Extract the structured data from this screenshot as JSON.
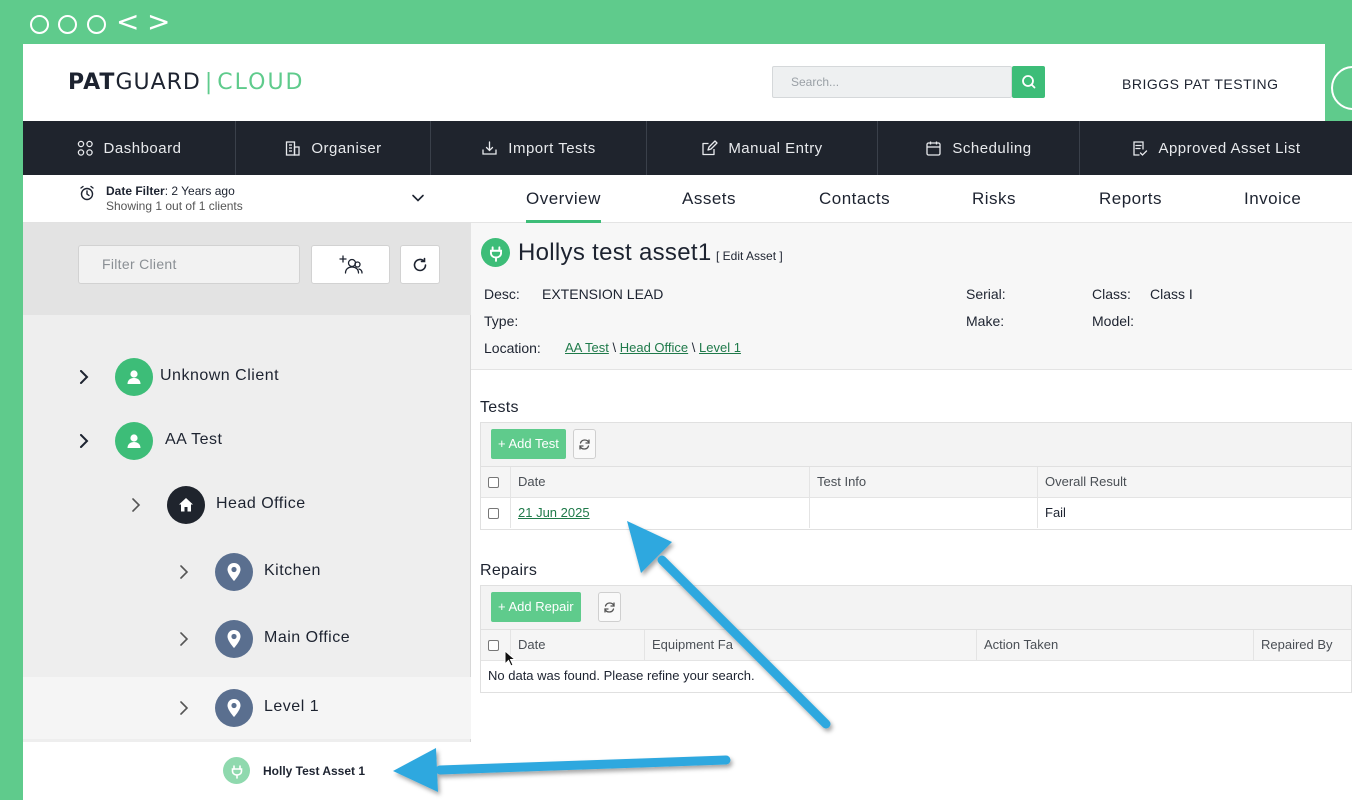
{
  "header": {
    "logo_bold": "PAT",
    "logo_regular": "GUARD",
    "logo_sep": "|",
    "logo_cloud": "CLOUD",
    "search_placeholder": "Search...",
    "company": "BRIGGS PAT TESTING"
  },
  "navbar": {
    "items": [
      {
        "label": "Dashboard",
        "icon": "grid-icon"
      },
      {
        "label": "Organiser",
        "icon": "building-icon"
      },
      {
        "label": "Import Tests",
        "icon": "download-icon"
      },
      {
        "label": "Manual Entry",
        "icon": "edit-icon"
      },
      {
        "label": "Scheduling",
        "icon": "calendar-icon"
      },
      {
        "label": "Approved Asset List",
        "icon": "approved-list-icon"
      }
    ]
  },
  "sidebar": {
    "date_filter_label": "Date Filter",
    "date_filter_value": ": 2 Years ago",
    "showing": "Showing 1 out of 1 clients",
    "filter_placeholder": "Filter Client",
    "tree": [
      {
        "label": "Unknown Client",
        "type": "client"
      },
      {
        "label": "AA Test",
        "type": "client"
      },
      {
        "label": "Head Office",
        "type": "site"
      },
      {
        "label": "Kitchen",
        "type": "location"
      },
      {
        "label": "Main Office",
        "type": "location"
      },
      {
        "label": "Level 1",
        "type": "location"
      },
      {
        "label": "Holly Test Asset 1",
        "type": "asset"
      }
    ]
  },
  "tabs": [
    "Overview",
    "Assets",
    "Contacts",
    "Risks",
    "Reports",
    "Invoice"
  ],
  "asset": {
    "title": "Hollys test asset1",
    "edit": "[ Edit Asset ]",
    "desc_label": "Desc:",
    "desc_value": "EXTENSION LEAD",
    "type_label": "Type:",
    "location_label": "Location:",
    "location_path": [
      "AA Test",
      "Head Office",
      "Level 1"
    ],
    "path_sep": "\\",
    "serial_label": "Serial:",
    "make_label": "Make:",
    "class_label": "Class:",
    "class_value": "Class I",
    "model_label": "Model:"
  },
  "tests": {
    "title": "Tests",
    "add_label": "Add Test",
    "columns": [
      "Date",
      "Test Info",
      "Overall Result"
    ],
    "rows": [
      {
        "date": "21 Jun 2025",
        "info": "",
        "result": "Fail"
      }
    ]
  },
  "repairs": {
    "title": "Repairs",
    "add_label": "Add Repair",
    "columns": [
      "Date",
      "Equipment Fa",
      "Action Taken",
      "Repaired By"
    ],
    "empty": "No data was found. Please refine your search."
  },
  "colors": {
    "brand_green": "#5fcb8c",
    "nav_dark": "#1f242d",
    "arrow_blue": "#2ea8df"
  }
}
